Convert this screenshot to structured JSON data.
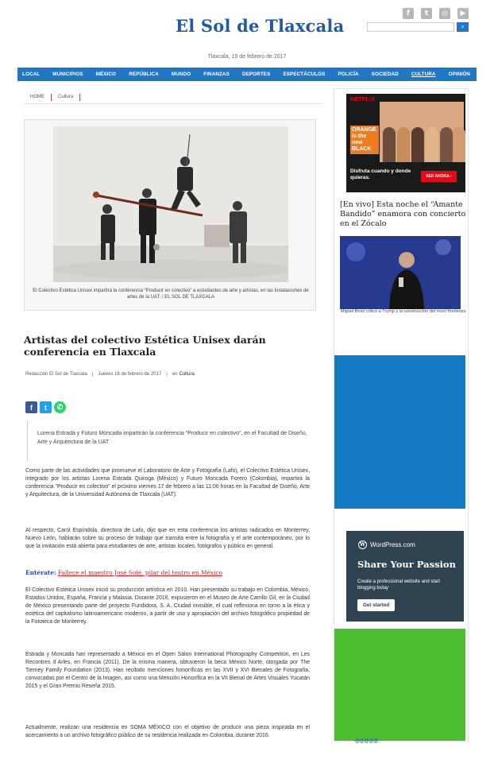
{
  "site": {
    "logo": "El Sol de Tlaxcala",
    "date": "Tlaxcala, 19 de febrero de 2017",
    "social_icons": [
      "facebook-icon",
      "twitter-icon",
      "instagram-icon",
      "youtube-icon"
    ]
  },
  "nav": {
    "items": [
      "LOCAL",
      "MUNICIPIOS",
      "MÉXICO",
      "REPÚBLICA",
      "MUNDO",
      "FINANZAS",
      "DEPORTES",
      "ESPECTÁCULOS",
      "POLICÍA",
      "SOCIEDAD",
      "CULTURA",
      "OPINIÓN"
    ],
    "active": "CULTURA"
  },
  "breadcrumb": {
    "home": "HOME",
    "section": "Cultura"
  },
  "article": {
    "caption": "El Colectivo Estética Unisex impartirá la conferencia “Producir en colectivo” a estudiantes de arte y artistas, en las instalaciones de artes de la UAT. / EL SOL DE TLAXCALA",
    "headline": "Artistas del colectivo Estética Unisex darán conferencia en Tlaxcala",
    "author": "Redacción El Sol de Tlaxcala",
    "date": "Jueves 16 de febrero de 2017",
    "in_label": "en",
    "category": "Cultura",
    "summary": "Lorena Estrada y Futuro Moncada impartirán la conferencia “Producir en colectivo”, en el Facultad de Diseño, Arte y Arquitectura de la UAT",
    "paragraphs": [
      "Como parte de las actividades que promueve el Laboratorio de Arte y Fotografía (Lafo), el Colectivo Estética Unisex, integrado por los artistas Lorena Estrada Quiroga (México) y Futuro Moncada Forero (Colombia), impartirá la conferencia “Producir en colectivo” el próximo viernes 17 de febrero a las 11:00 horas en la Facultad de Diseño, Arte y Arquitectura, de la Universidad Autónoma de Tlaxcala (UAT).",
      "Al respecto, Carol Espíndola, directora de Lafo, dijo que en esta conferencia los artistas radicados en Monterrey, Nuevo León, hablarán sobre su proceso de trabajo que transita entre la fotografía y el arte contemporáneo, por lo que la invitación está abierta para estudiantes de arte, artistas locales, fotógrafos y público en general.",
      "El Colectivo Estética Unisex inició su producción artística en 2010. Han presentado su trabajo en Colombia, México, Estados Unidos, España, Francia y Malasia. Durante 2016, expusieron en el Museo de Arte Carrillo Gil, en la Ciudad de México presentando parte del proyecto Fundidora, S. A. Ciudad invisible, el cual reflexiona en torno a la ética y estética del capitalismo latinoamericano moderno, a partir de uso y apropiación del archivo fotográfico propiedad de la Fototeca de Monterrey.",
      "Estrada y Moncada han representado a México en el Open Salon International Photography Competition, en Les Recontres d´Arles, en Francia (2011). De la misma manera, obtuvieron la beca México Norte, otorgada por The Tierney Family Foundation (2013). Han recibido menciones honoríficas en las XVII y XVI Bienales de Fotografía, convocadas por el Centro de la Imagen, así como una Mención Honorífica en la VII Bienal de Artes Visuales Yucatán 2015 y el Gran Premio Reseña 2015.",
      "Actualmente, realizan una residencia en SOMA MÉXICO con el objetivo de producir una pieza inspirada en el acercamiento a un archivo fotográfico público de su residencia realizada en Colombia, durante 2016."
    ],
    "enterate_label": "Entérate:",
    "enterate_link": "Fallece el maestro José Solé, pilar del teatro en México"
  },
  "sidebar": {
    "netflix_ad": {
      "brand": "NETFLIX",
      "show": "ORANGE is the new BLACK",
      "tagline": "Disfruta cuando y donde quieras.",
      "cta": "VER AHORA ›"
    },
    "news": {
      "title": "[En vivo] Esta noche el “Amante Bandido” enamora con concierto en el Zócalo",
      "caption": "Miguel Bosé criticó a Trump y la construcción del muro fronterizo"
    },
    "wp_ad": {
      "brand": "WordPress.com",
      "headline": "Share Your Passion",
      "sub": "Create a professional website and start blogging today",
      "cta": "Get started"
    },
    "green_ad_tag": "@@@@@"
  },
  "colors": {
    "nav": "#1f77c6",
    "accent": "#d33333",
    "logo": "#1f5aa6",
    "link": "#d31f1f"
  }
}
